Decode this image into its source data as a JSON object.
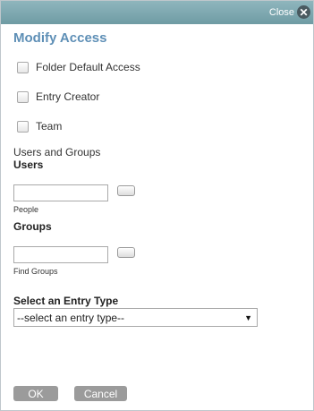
{
  "titlebar": {
    "close_label": "Close",
    "close_icon": "close-icon"
  },
  "dialog": {
    "title": "Modify Access"
  },
  "access_options": [
    {
      "label": "Folder Default Access",
      "checked": false
    },
    {
      "label": "Entry Creator",
      "checked": false
    },
    {
      "label": "Team",
      "checked": false
    }
  ],
  "users_groups": {
    "section_label": "Users and Groups",
    "users_label": "Users",
    "users_value": "",
    "people_hint": "People",
    "groups_label": "Groups",
    "groups_value": "",
    "find_groups_hint": "Find Groups"
  },
  "entry_type": {
    "label": "Select an Entry Type",
    "selected": "--select an entry type--"
  },
  "buttons": {
    "ok": "OK",
    "cancel": "Cancel"
  },
  "colors": {
    "title_accent": "#5e8fb6",
    "titlebar": "#7aa6ad",
    "button_gray": "#9b9b9b"
  }
}
